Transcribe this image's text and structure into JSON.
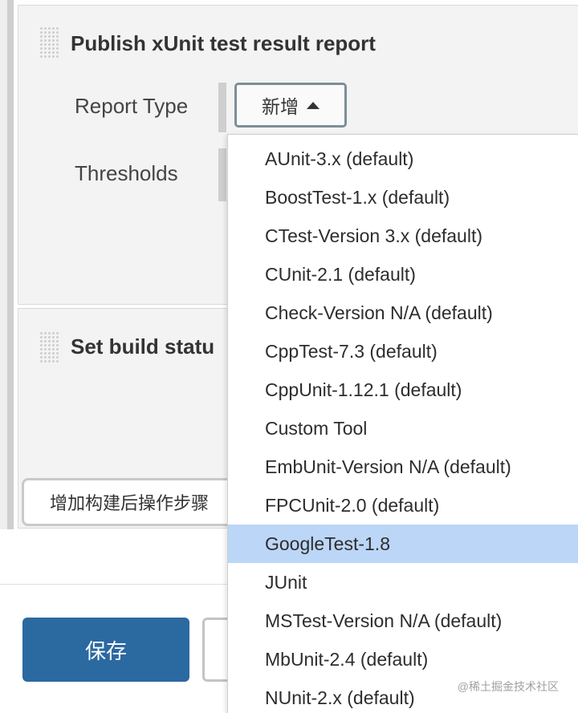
{
  "sections": [
    {
      "title": "Publish xUnit test result report",
      "fields": [
        {
          "label": "Report Type"
        },
        {
          "label": "Thresholds"
        }
      ],
      "report_type_button": "新增"
    },
    {
      "title": "Set build statu"
    }
  ],
  "add_step_button": "增加构建后操作步骤",
  "save_button": "保存",
  "dropdown": {
    "items": [
      "AUnit-3.x (default)",
      "BoostTest-1.x (default)",
      "CTest-Version 3.x (default)",
      "CUnit-2.1 (default)",
      "Check-Version N/A (default)",
      "CppTest-7.3 (default)",
      "CppUnit-1.12.1 (default)",
      "Custom Tool",
      "EmbUnit-Version N/A (default)",
      "FPCUnit-2.0 (default)",
      "GoogleTest-1.8",
      "JUnit",
      "MSTest-Version N/A (default)",
      "MbUnit-2.4 (default)",
      "NUnit-2.x (default)"
    ],
    "selected": "GoogleTest-1.8"
  },
  "watermark": "@稀土掘金技术社区",
  "colors": {
    "accent": "#2b69a1",
    "selected_item": "#bcd6f7",
    "panel": "#f3f3f4"
  }
}
